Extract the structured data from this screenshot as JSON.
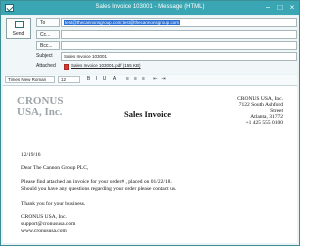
{
  "window": {
    "title": "Sales Invoice 103001 - Message (HTML)",
    "controls": {
      "minimize": "−",
      "maximize": "□",
      "close": "×"
    }
  },
  "compose": {
    "send_label": "Send",
    "to_label": "To",
    "to_value": "test@thecannonsgroup.com;test@thecannonsgroup.com",
    "cc_label": "Cc...",
    "cc_value": "",
    "bcc_label": "Bcc...",
    "bcc_value": "",
    "subject_label": "Subject",
    "subject_value": "Sales Invoice 103001",
    "attached_label": "Attached",
    "attachment_name": "Sales Invoice 103001.pdf (155 KB)"
  },
  "format_bar": {
    "font_name": "Times New Roman",
    "font_size": "12",
    "tools": [
      "B",
      "I",
      "U",
      "A",
      "≡",
      "≡",
      "≡",
      "⇤",
      "⇥"
    ]
  },
  "document": {
    "company_logo_line1": "CRONUS",
    "company_logo_line2": "USA, Inc.",
    "title": "Sales Invoice",
    "address": [
      "CRONUS USA, Inc.",
      "7122 South Ashford",
      "Street",
      "Atlanta, 31772",
      "+1 425 555 0100"
    ],
    "date": "12/19/16",
    "greeting": "Dear The Cannon Group PLC,",
    "body_line1": "Please find attached an invoice for your order# , placed on 01/22/18.",
    "body_line2": "Should you have any questions regarding your order please contact us.",
    "thanks": "Thank you for your business.",
    "signature": [
      "CRONUS USA, Inc.",
      "support@cronususa.com",
      "www.cronususa.com"
    ]
  },
  "colors": {
    "titlebar": "#3aa6b3",
    "selection": "#2a6fd3",
    "logo": "#9ca4a8",
    "attachment_icon": "#d73b31"
  }
}
